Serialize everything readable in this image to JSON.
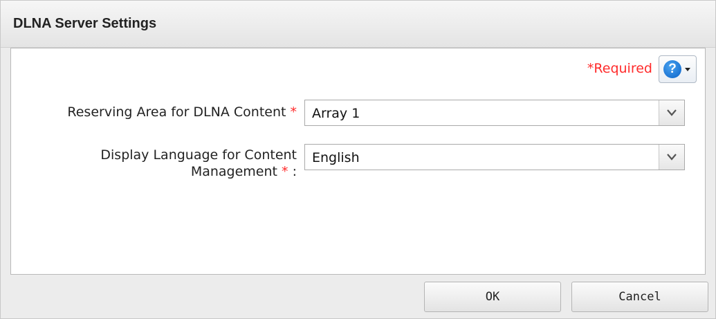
{
  "dialog": {
    "title": "DLNA Server Settings",
    "required_label": "*Required",
    "help_icon": "question-circle-icon"
  },
  "fields": [
    {
      "label": "Reserving Area for DLNA Content",
      "asterisk": "*",
      "suffix": "",
      "value": "Array 1"
    },
    {
      "label_line1": "Display Language for Content",
      "label_line2": "Management",
      "asterisk": "*",
      "suffix": " :",
      "value": "English"
    }
  ],
  "buttons": {
    "ok": "OK",
    "cancel": "Cancel"
  },
  "colors": {
    "required": "#ff2a2a",
    "help_icon": "#0a62c8"
  }
}
